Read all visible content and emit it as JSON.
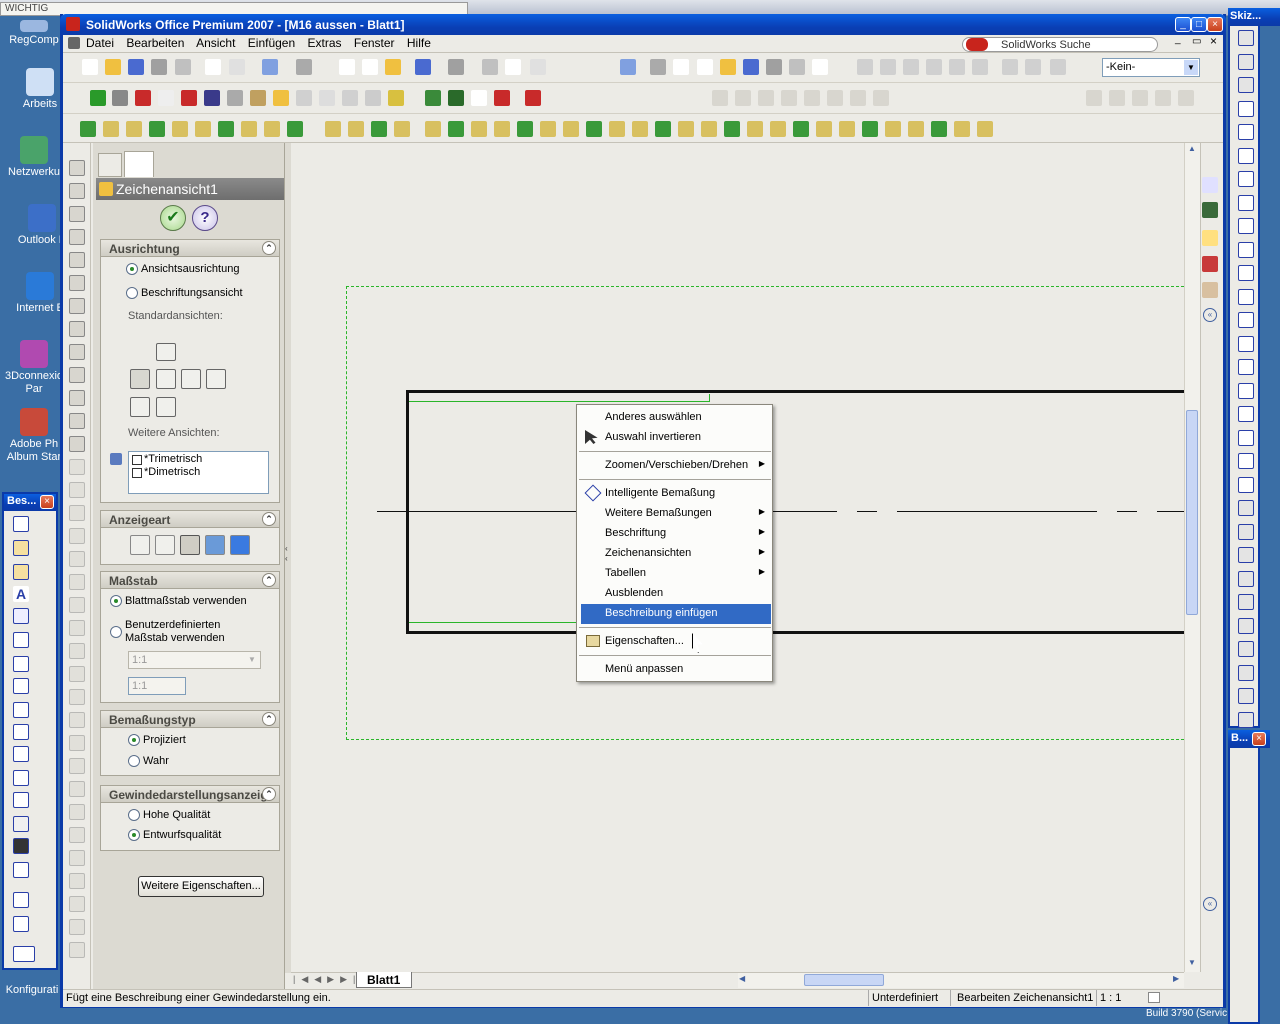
{
  "taskbar": {
    "items": [
      "WICHTIG"
    ]
  },
  "desktop": {
    "icons": [
      "RegComp",
      "Arbeits",
      "Netzwerku",
      "Outlook E",
      "Internet E",
      "3Dconnexio Par",
      "Adobe Ph Album Star",
      "Konfigurati"
    ]
  },
  "window": {
    "title": "SolidWorks Office Premium 2007 - [M16 aussen - Blatt1]",
    "minimize": "_",
    "maximize": "□",
    "close": "×"
  },
  "menubar": {
    "items": [
      "Datei",
      "Bearbeiten",
      "Ansicht",
      "Einfügen",
      "Extras",
      "Fenster",
      "Hilfe"
    ],
    "search_label": "SolidWorks Suche",
    "restore": "▭",
    "min": "_",
    "close": "×"
  },
  "toolbar": {
    "layer_select": "-Kein-"
  },
  "property_manager": {
    "title": "Zeichenansicht1",
    "ok": "✔",
    "help": "?",
    "ausrichtung": {
      "header": "Ausrichtung",
      "opt1": "Ansichtsausrichtung",
      "opt2": "Beschriftungsansicht",
      "std_label": "Standardansichten:",
      "more_label": "Weitere Ansichten:",
      "list": [
        "*Trimetrisch",
        "*Dimetrisch"
      ]
    },
    "anzeigeart": {
      "header": "Anzeigeart"
    },
    "massstab": {
      "header": "Maßstab",
      "opt1": "Blattmaßstab verwenden",
      "opt2": "Benutzerdefinierten Maßstab verwenden",
      "select": "1:1",
      "input": "1:1"
    },
    "bemassungstyp": {
      "header": "Bemaßungstyp",
      "opt1": "Projiziert",
      "opt2": "Wahr"
    },
    "gewinde": {
      "header": "Gewindedarstellungsanzeig",
      "opt1": "Hohe Qualität",
      "opt2": "Entwurfsqualität"
    },
    "more_button": "Weitere Eigenschaften..."
  },
  "context_menu": {
    "items": [
      {
        "label": "Anderes auswählen",
        "sub": false
      },
      {
        "label": "Auswahl invertieren",
        "sub": false
      },
      {
        "label": "Zoomen/Verschieben/Drehen",
        "sub": true
      },
      {
        "label": "Intelligente Bemaßung",
        "sub": false
      },
      {
        "label": "Weitere Bemaßungen",
        "sub": true
      },
      {
        "label": "Beschriftung",
        "sub": true
      },
      {
        "label": "Zeichenansichten",
        "sub": true
      },
      {
        "label": "Tabellen",
        "sub": true
      },
      {
        "label": "Ausblenden",
        "sub": false
      },
      {
        "label": "Beschreibung einfügen",
        "sub": false
      },
      {
        "label": "Eigenschaften...",
        "sub": false
      },
      {
        "label": "Menü anpassen",
        "sub": false
      }
    ],
    "arrow": "▶"
  },
  "sheet_tab": "Blatt1",
  "statusbar": {
    "message": "Fügt eine Beschreibung einer Gewindedarstellung ein.",
    "state": "Unterdefiniert",
    "mode": "Bearbeiten Zeichenansicht1",
    "scale": "1 : 1",
    "build": "Build 3790 (Servic"
  },
  "floating": {
    "left_title": "Bes...",
    "right_top_title": "Skiz...",
    "right_bottom_title": "B..."
  }
}
